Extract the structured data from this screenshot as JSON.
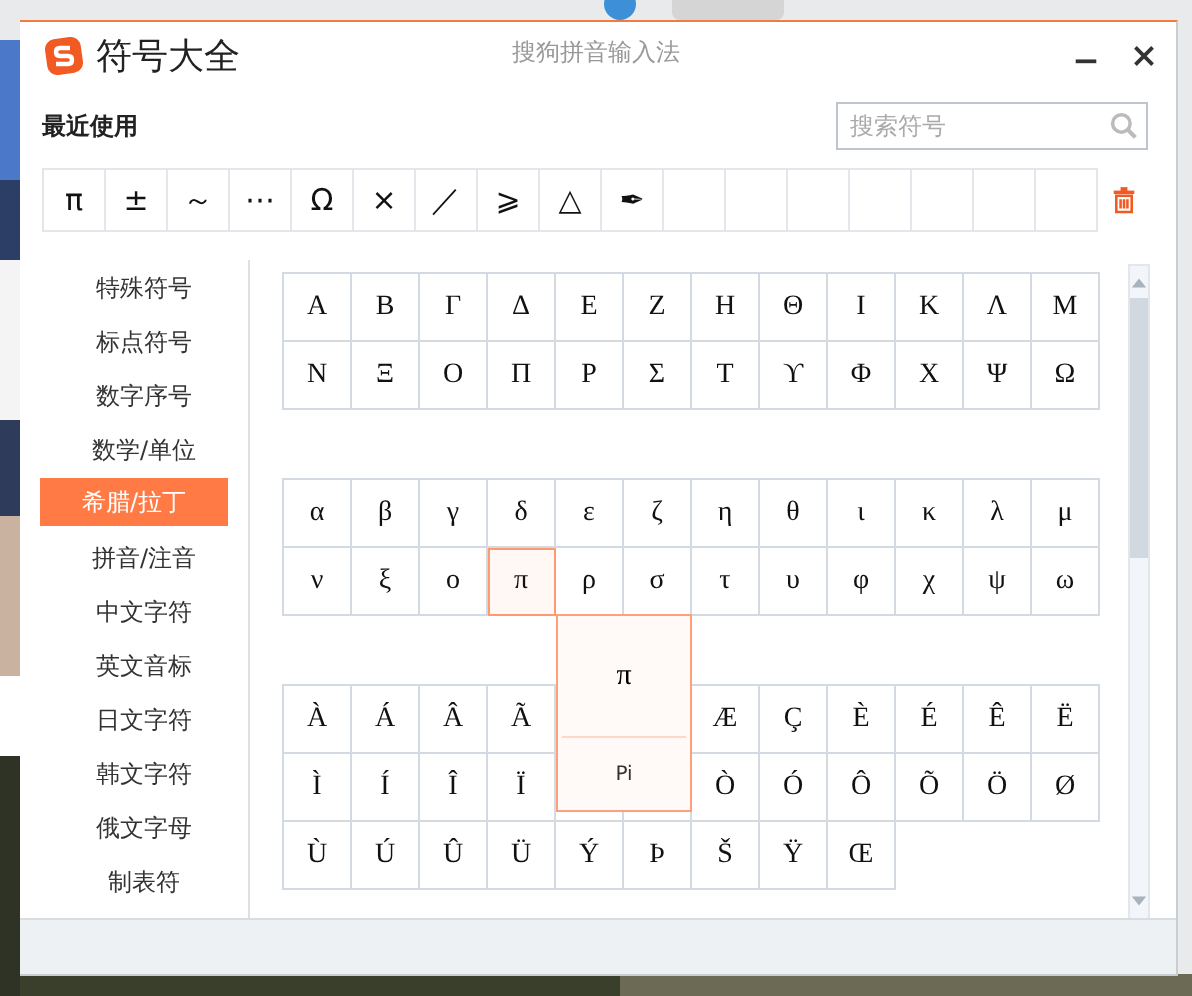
{
  "window": {
    "title": "符号大全",
    "subtitle": "搜狗拼音输入法"
  },
  "recent": {
    "label": "最近使用",
    "symbols": [
      "π",
      "±",
      "～",
      "⋯",
      "Ω",
      "×",
      "／",
      "⩾",
      "△",
      "✒"
    ]
  },
  "search": {
    "placeholder": "搜索符号"
  },
  "categories": [
    {
      "label": "特殊符号",
      "selected": false
    },
    {
      "label": "标点符号",
      "selected": false
    },
    {
      "label": "数字序号",
      "selected": false
    },
    {
      "label": "数学/单位",
      "selected": false
    },
    {
      "label": "希腊/拉丁",
      "selected": true
    },
    {
      "label": "拼音/注音",
      "selected": false
    },
    {
      "label": "中文字符",
      "selected": false
    },
    {
      "label": "英文音标",
      "selected": false
    },
    {
      "label": "日文字符",
      "selected": false
    },
    {
      "label": "韩文字符",
      "selected": false
    },
    {
      "label": "俄文字母",
      "selected": false
    },
    {
      "label": "制表符",
      "selected": false
    }
  ],
  "symbol_groups": [
    {
      "rows": [
        [
          {
            "symbol": "Α",
            "selected": false
          },
          {
            "symbol": "Β",
            "selected": false
          },
          {
            "symbol": "Γ",
            "selected": false
          },
          {
            "symbol": "Δ",
            "selected": false
          },
          {
            "symbol": "Ε",
            "selected": false
          },
          {
            "symbol": "Ζ",
            "selected": false
          },
          {
            "symbol": "Η",
            "selected": false
          },
          {
            "symbol": "Θ",
            "selected": false
          },
          {
            "symbol": "Ι",
            "selected": false
          },
          {
            "symbol": "Κ",
            "selected": false
          },
          {
            "symbol": "Λ",
            "selected": false
          },
          {
            "symbol": "Μ",
            "selected": false
          }
        ],
        [
          {
            "symbol": "Ν",
            "selected": false
          },
          {
            "symbol": "Ξ",
            "selected": false
          },
          {
            "symbol": "Ο",
            "selected": false
          },
          {
            "symbol": "Π",
            "selected": false
          },
          {
            "symbol": "Ρ",
            "selected": false
          },
          {
            "symbol": "Σ",
            "selected": false
          },
          {
            "symbol": "Τ",
            "selected": false
          },
          {
            "symbol": "ϒ",
            "selected": false
          },
          {
            "symbol": "Φ",
            "selected": false
          },
          {
            "symbol": "Χ",
            "selected": false
          },
          {
            "symbol": "Ψ",
            "selected": false
          },
          {
            "symbol": "Ω",
            "selected": false
          }
        ]
      ]
    },
    {
      "rows": [
        [
          {
            "symbol": "α",
            "selected": false
          },
          {
            "symbol": "β",
            "selected": false
          },
          {
            "symbol": "γ",
            "selected": false
          },
          {
            "symbol": "δ",
            "selected": false
          },
          {
            "symbol": "ε",
            "selected": false
          },
          {
            "symbol": "ζ",
            "selected": false
          },
          {
            "symbol": "η",
            "selected": false
          },
          {
            "symbol": "θ",
            "selected": false
          },
          {
            "symbol": "ι",
            "selected": false
          },
          {
            "symbol": "κ",
            "selected": false
          },
          {
            "symbol": "λ",
            "selected": false
          },
          {
            "symbol": "μ",
            "selected": false
          }
        ],
        [
          {
            "symbol": "ν",
            "selected": false
          },
          {
            "symbol": "ξ",
            "selected": false
          },
          {
            "symbol": "ο",
            "selected": false
          },
          {
            "symbol": "π",
            "selected": true
          },
          {
            "symbol": "ρ",
            "selected": false
          },
          {
            "symbol": "σ",
            "selected": false
          },
          {
            "symbol": "τ",
            "selected": false
          },
          {
            "symbol": "υ",
            "selected": false
          },
          {
            "symbol": "φ",
            "selected": false
          },
          {
            "symbol": "χ",
            "selected": false
          },
          {
            "symbol": "ψ",
            "selected": false
          },
          {
            "symbol": "ω",
            "selected": false
          }
        ]
      ]
    },
    {
      "rows": [
        [
          {
            "symbol": "À",
            "selected": false
          },
          {
            "symbol": "Á",
            "selected": false
          },
          {
            "symbol": "Â",
            "selected": false
          },
          {
            "symbol": "Ã",
            "selected": false
          },
          null,
          null,
          {
            "symbol": "Æ",
            "selected": false
          },
          {
            "symbol": "Ç",
            "selected": false
          },
          {
            "symbol": "È",
            "selected": false
          },
          {
            "symbol": "É",
            "selected": false
          },
          {
            "symbol": "Ê",
            "selected": false
          },
          {
            "symbol": "Ë",
            "selected": false
          }
        ],
        [
          {
            "symbol": "Ì",
            "selected": false
          },
          {
            "symbol": "Í",
            "selected": false
          },
          {
            "symbol": "Î",
            "selected": false
          },
          {
            "symbol": "Ï",
            "selected": false
          },
          null,
          null,
          {
            "symbol": "Ò",
            "selected": false
          },
          {
            "symbol": "Ó",
            "selected": false
          },
          {
            "symbol": "Ô",
            "selected": false
          },
          {
            "symbol": "Õ",
            "selected": false
          },
          {
            "symbol": "Ö",
            "selected": false
          },
          {
            "symbol": "Ø",
            "selected": false
          }
        ],
        [
          {
            "symbol": "Ù",
            "selected": false
          },
          {
            "symbol": "Ú",
            "selected": false
          },
          {
            "symbol": "Û",
            "selected": false
          },
          {
            "symbol": "Ü",
            "selected": false
          },
          {
            "symbol": "Ý",
            "selected": false
          },
          {
            "symbol": "Þ",
            "selected": false
          },
          {
            "symbol": "Š",
            "selected": false
          },
          {
            "symbol": "Ÿ",
            "selected": false
          },
          {
            "symbol": "Œ",
            "selected": false
          }
        ]
      ]
    }
  ],
  "tooltip": {
    "symbol": "π",
    "name": "Pi"
  }
}
